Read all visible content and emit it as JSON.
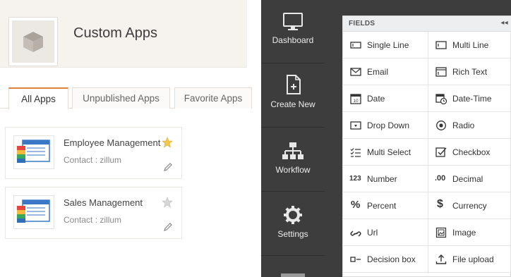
{
  "left": {
    "title": "Custom Apps",
    "tabs": [
      {
        "label": "All Apps",
        "active": true
      },
      {
        "label": "Unpublished Apps",
        "active": false
      },
      {
        "label": "Favorite Apps",
        "active": false
      }
    ],
    "apps": [
      {
        "name": "Employee Management",
        "contact": "Contact : zillum",
        "favorite": true
      },
      {
        "name": "Sales Management",
        "contact": "Contact : zillum",
        "favorite": false
      }
    ]
  },
  "sidebar": {
    "items": [
      {
        "label": "Dashboard",
        "icon": "monitor-icon"
      },
      {
        "label": "Create New",
        "icon": "new-file-icon"
      },
      {
        "label": "Workflow",
        "icon": "workflow-icon"
      },
      {
        "label": "Settings",
        "icon": "gear-icon"
      }
    ]
  },
  "fields": {
    "title": "FIELDS",
    "collapse_glyph": "◂◂",
    "items": [
      {
        "label": "Single Line",
        "icon": "single-line-icon"
      },
      {
        "label": "Multi Line",
        "icon": "multi-line-icon"
      },
      {
        "label": "Email",
        "icon": "email-icon"
      },
      {
        "label": "Rich Text",
        "icon": "rich-text-icon"
      },
      {
        "label": "Date",
        "icon": "date-icon",
        "icon_text": "10"
      },
      {
        "label": "Date-Time",
        "icon": "date-time-icon"
      },
      {
        "label": "Drop Down",
        "icon": "dropdown-icon"
      },
      {
        "label": "Radio",
        "icon": "radio-icon"
      },
      {
        "label": "Multi Select",
        "icon": "multi-select-icon"
      },
      {
        "label": "Checkbox",
        "icon": "checkbox-icon"
      },
      {
        "label": "Number",
        "icon": "number-icon",
        "icon_text": "123"
      },
      {
        "label": "Decimal",
        "icon": "decimal-icon",
        "icon_text": ".00"
      },
      {
        "label": "Percent",
        "icon": "percent-icon",
        "icon_text": "%"
      },
      {
        "label": "Currency",
        "icon": "currency-icon",
        "icon_text": "$"
      },
      {
        "label": "Url",
        "icon": "link-icon"
      },
      {
        "label": "Image",
        "icon": "image-icon"
      },
      {
        "label": "Decision box",
        "icon": "decision-box-icon"
      },
      {
        "label": "File upload",
        "icon": "upload-icon"
      }
    ]
  },
  "colors": {
    "accent_tab": "#e0813a",
    "sidebar_bg": "#3d3d3d",
    "star_active": "#f2c94c",
    "star_inactive": "#cfcfcf"
  }
}
